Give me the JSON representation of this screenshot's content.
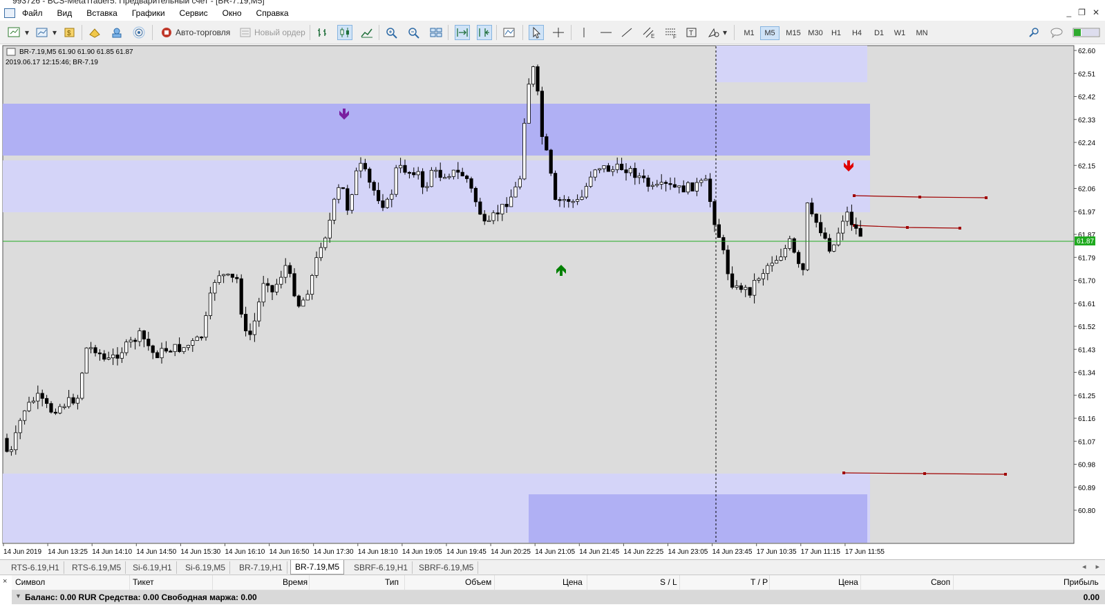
{
  "window": {
    "title": "993726 - BCS-MetaTrader5: Предварительный счет - [BR-7.19,M5]"
  },
  "menu": [
    "Файл",
    "Вид",
    "Вставка",
    "Графики",
    "Сервис",
    "Окно",
    "Справка"
  ],
  "toolbar": {
    "autotrade_label": "Авто-торговля",
    "new_order_label": "Новый ордер",
    "timeframes": [
      "M1",
      "M5",
      "M15",
      "M30",
      "H1",
      "H4",
      "D1",
      "W1",
      "MN"
    ],
    "active_timeframe": "M5"
  },
  "chart": {
    "info_line1": "BR-7.19,M5  61.90 61.90 61.85 61.87",
    "info_line2": "2019.06.17 12:15:46; BR-7.19",
    "current_price_label": "61.87",
    "bid_line_color": "#1faa1f",
    "price_axis": [
      "62.60",
      "62.51",
      "62.42",
      "62.33",
      "62.24",
      "62.15",
      "62.06",
      "61.97",
      "61.87",
      "61.79",
      "61.70",
      "61.61",
      "61.52",
      "61.43",
      "61.34",
      "61.25",
      "61.16",
      "61.07",
      "60.98",
      "60.89",
      "60.80"
    ],
    "time_axis": [
      "14 Jun 2019",
      "14 Jun 13:25",
      "14 Jun 14:10",
      "14 Jun 14:50",
      "14 Jun 15:30",
      "14 Jun 16:10",
      "14 Jun 16:50",
      "14 Jun 17:30",
      "14 Jun 18:10",
      "14 Jun 19:05",
      "14 Jun 19:45",
      "14 Jun 20:25",
      "14 Jun 21:05",
      "14 Jun 21:45",
      "14 Jun 22:25",
      "14 Jun 23:05",
      "14 Jun 23:45",
      "17 Jun 10:35",
      "17 Jun 11:15",
      "17 Jun 11:55"
    ],
    "colors": {
      "background": "#dcdcdc",
      "zone_light": "#d4d4f8",
      "zone_dark": "#b0b0f4",
      "arrow_up": "#008000",
      "arrow_down_purple": "#7a1fa0",
      "arrow_down_red": "#e00000",
      "level_line": "#a00000"
    }
  },
  "symbol_tabs": [
    "RTS-6.19,H1",
    "RTS-6.19,M5",
    "Si-6.19,H1",
    "Si-6.19,M5",
    "BR-7.19,H1",
    "BR-7.19,M5",
    "SBRF-6.19,H1",
    "SBRF-6.19,M5"
  ],
  "active_tab": "BR-7.19,M5",
  "terminal": {
    "columns": [
      "Символ",
      "Тикет",
      "Время",
      "Тип",
      "Объем",
      "Цена",
      "S / L",
      "T / P",
      "Цена",
      "Своп",
      "Прибыль"
    ],
    "balance_text": "Баланс: 0.00 RUR  Средства: 0.00  Свободная маржа: 0.00",
    "profit_total": "0.00"
  }
}
